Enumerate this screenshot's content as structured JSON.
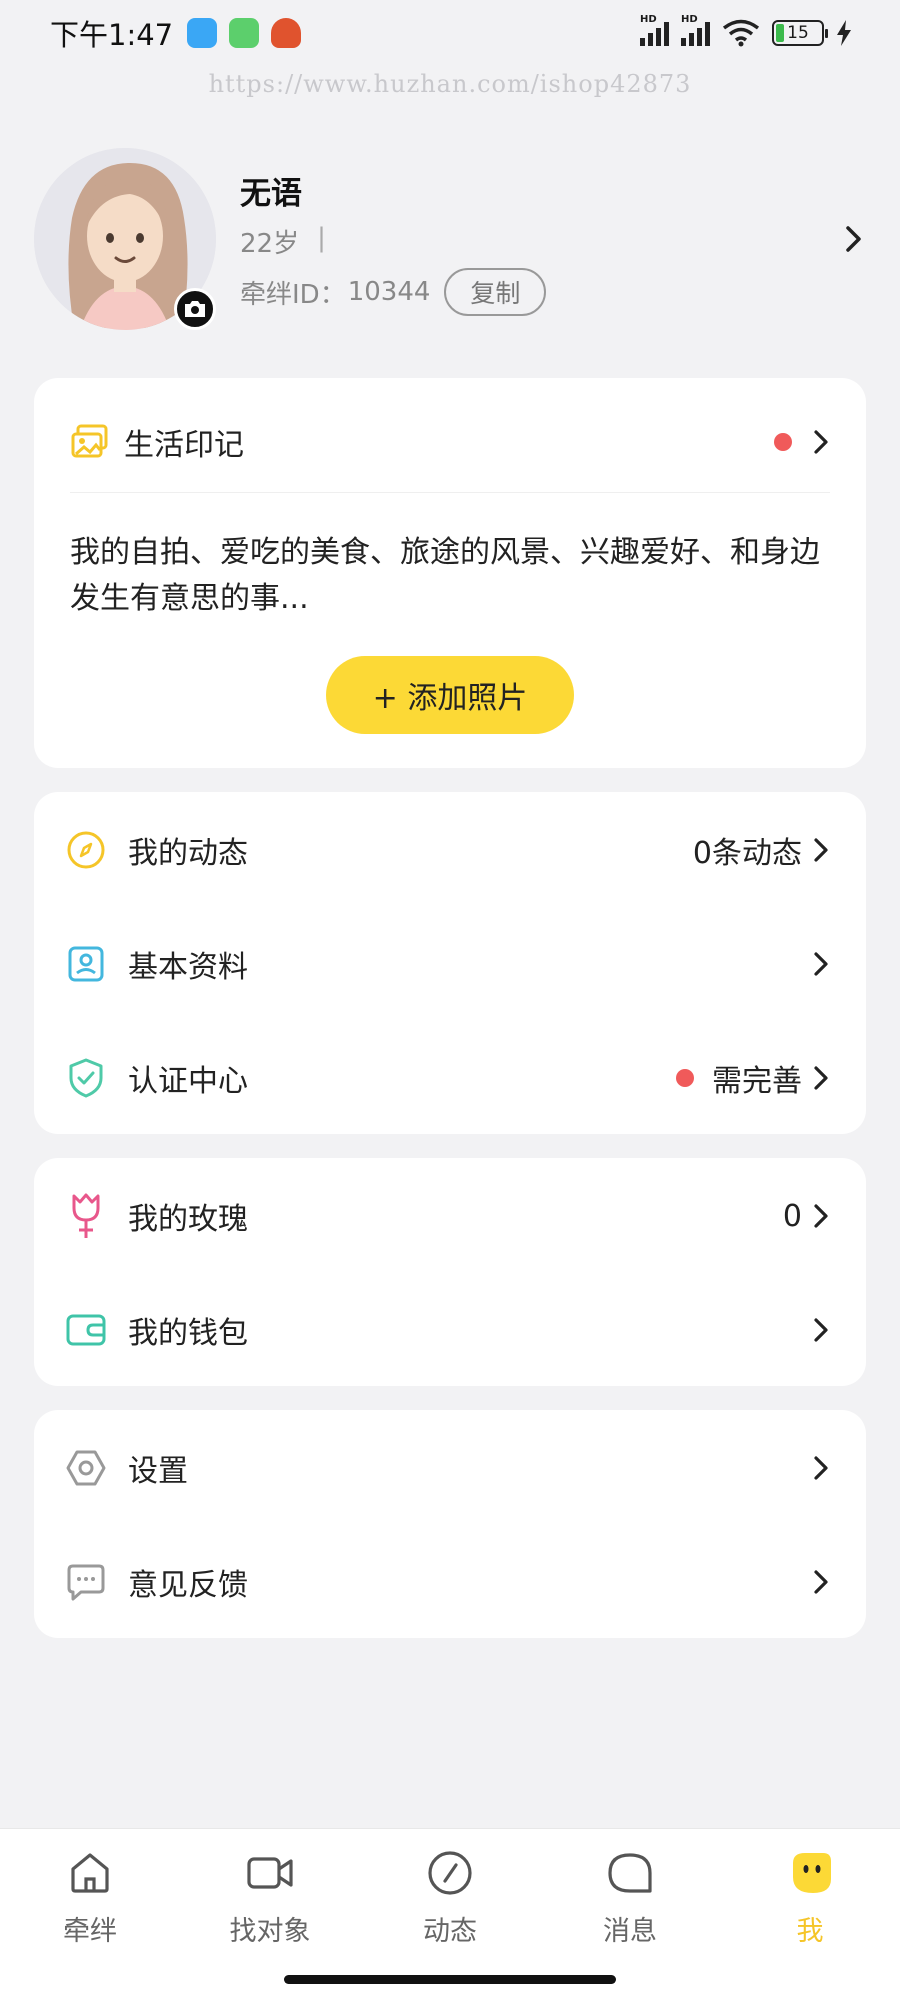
{
  "status_bar": {
    "time": "下午1:47",
    "battery": "15"
  },
  "watermark": "https://www.huzhan.com/ishop42873",
  "profile": {
    "nickname": "无语",
    "age": "22岁",
    "separator": "|",
    "id_label": "牵绊ID：",
    "id_value": "10344",
    "copy_label": "复制"
  },
  "life_card": {
    "title": "生活印记",
    "description": "我的自拍、爱吃的美食、旅途的风景、兴趣爱好、和身边发生有意思的事...",
    "add_button": "+ 添加照片"
  },
  "menu_group_1": [
    {
      "label": "我的动态",
      "value": "0条动态",
      "icon": "compass-icon"
    },
    {
      "label": "基本资料",
      "value": "",
      "icon": "profile-card-icon"
    },
    {
      "label": "认证中心",
      "value": "需完善",
      "icon": "shield-check-icon"
    }
  ],
  "menu_group_2": [
    {
      "label": "我的玫瑰",
      "value": "0",
      "icon": "rose-icon"
    },
    {
      "label": "我的钱包",
      "value": "",
      "icon": "wallet-icon"
    }
  ],
  "menu_group_3": [
    {
      "label": "设置",
      "value": "",
      "icon": "settings-icon"
    },
    {
      "label": "意见反馈",
      "value": "",
      "icon": "feedback-icon"
    }
  ],
  "tabs": [
    {
      "label": "牵绊",
      "icon": "home-icon"
    },
    {
      "label": "找对象",
      "icon": "video-icon"
    },
    {
      "label": "动态",
      "icon": "compass-icon"
    },
    {
      "label": "消息",
      "icon": "message-icon"
    },
    {
      "label": "我",
      "icon": "smiley-icon",
      "active": true
    }
  ],
  "colors": {
    "accent": "#fcd936",
    "tab_active": "#f5c528",
    "alert_dot": "#f05a5a",
    "background": "#f2f2f4"
  }
}
